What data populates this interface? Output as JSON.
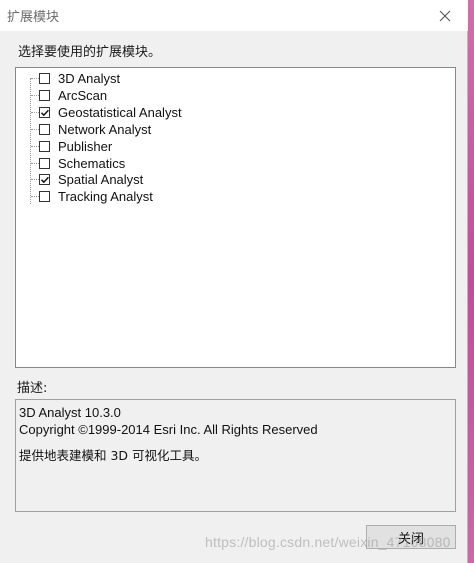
{
  "window": {
    "title": "扩展模块"
  },
  "instruction": "选择要使用的扩展模块。",
  "extensions": [
    {
      "label": "3D Analyst",
      "checked": false
    },
    {
      "label": "ArcScan",
      "checked": false
    },
    {
      "label": "Geostatistical Analyst",
      "checked": true
    },
    {
      "label": "Network Analyst",
      "checked": false
    },
    {
      "label": "Publisher",
      "checked": false
    },
    {
      "label": "Schematics",
      "checked": false
    },
    {
      "label": "Spatial Analyst",
      "checked": true
    },
    {
      "label": "Tracking Analyst",
      "checked": false
    }
  ],
  "description": {
    "label": "描述:",
    "product": "3D Analyst 10.3.0",
    "copyright": "Copyright ©1999-2014 Esri Inc. All Rights Reserved",
    "summary": "提供地表建模和 3D 可视化工具。"
  },
  "buttons": {
    "close_label": "关闭"
  },
  "watermark": "https://blog.csdn.net/weixin_47108080",
  "icons": {
    "close": "close-icon",
    "check": "check-icon"
  },
  "colors": {
    "dialog_bg": "#f0f0f0",
    "list_border": "#828790",
    "background_pink": "#c64f9f"
  }
}
